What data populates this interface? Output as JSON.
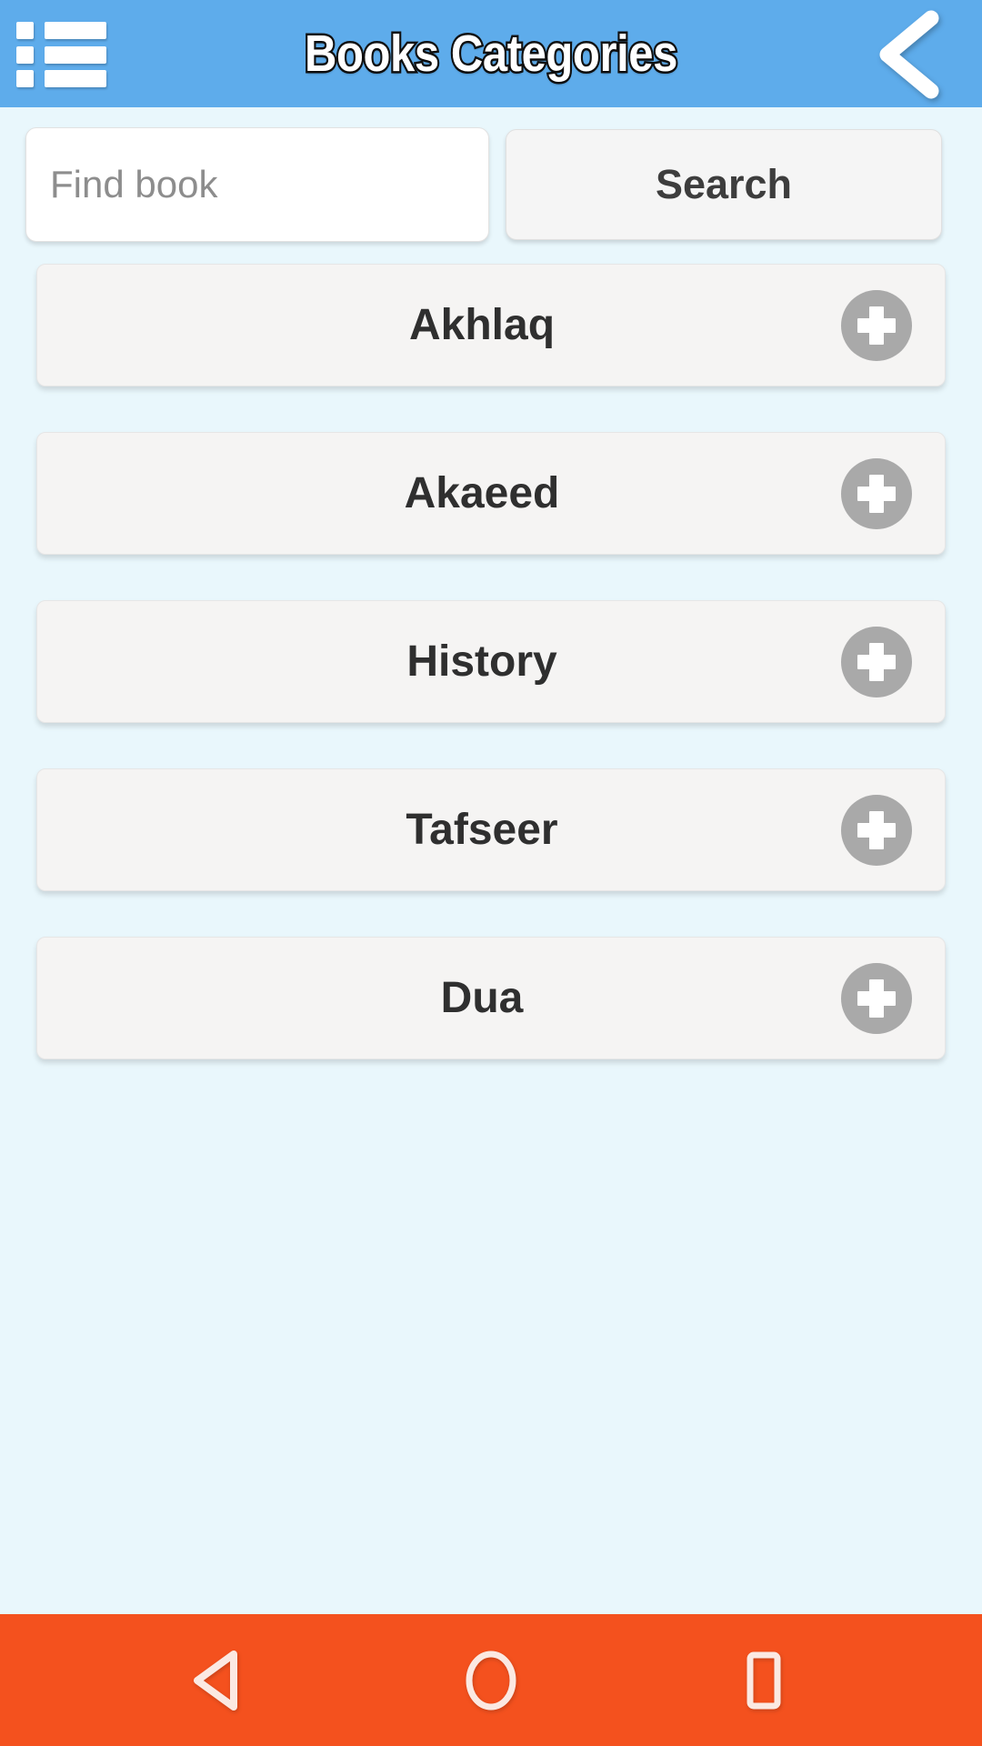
{
  "header": {
    "title": "Books Categories",
    "menu_icon": "list-menu-icon",
    "back_icon": "chevron-left-icon",
    "background_color": "#5eaceb",
    "title_color": "#ffffff",
    "title_outline_color": "#111111"
  },
  "search": {
    "placeholder": "Find book",
    "value": "",
    "button_label": "Search",
    "input_background": "#ffffff",
    "button_background": "#f5f5f5"
  },
  "categories": {
    "row_background": "#f5f4f3",
    "label_color": "#2f2f2f",
    "add_button_color": "#a9a9a9",
    "items": [
      {
        "label": "Akhlaq",
        "add_icon": "plus-icon"
      },
      {
        "label": "Akaeed",
        "add_icon": "plus-icon"
      },
      {
        "label": "History",
        "add_icon": "plus-icon"
      },
      {
        "label": "Tafseer",
        "add_icon": "plus-icon"
      },
      {
        "label": "Dua",
        "add_icon": "plus-icon"
      }
    ]
  },
  "page": {
    "background_color": "#e9f7fc"
  },
  "navbar": {
    "background_color": "#f4511e",
    "buttons": [
      {
        "name": "back-triangle-icon",
        "label": "Back"
      },
      {
        "name": "home-circle-icon",
        "label": "Home"
      },
      {
        "name": "recents-square-icon",
        "label": "Recents"
      }
    ]
  }
}
